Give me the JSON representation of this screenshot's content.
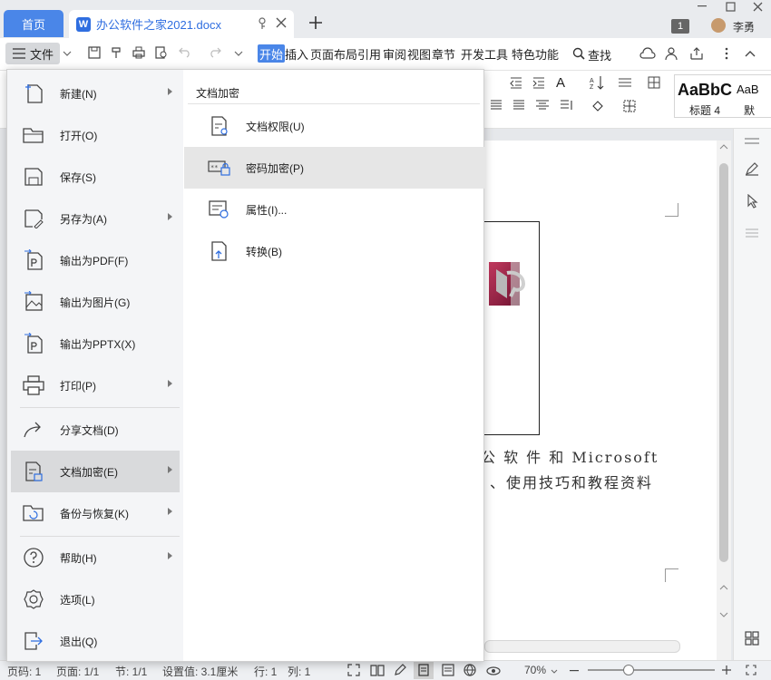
{
  "titlebar": {
    "home_tab": "首页",
    "doc_tab": "办公软件之家2021.docx",
    "doc_icon": "W",
    "badge": "1",
    "user_name": "李勇"
  },
  "toolbar": {
    "file_menu": "文件",
    "tabs": [
      "开始",
      "插入",
      "页面布局",
      "引用",
      "审阅",
      "视图",
      "章节",
      "开发工具",
      "特色功能"
    ],
    "search_label": "查找"
  },
  "ribbon": {
    "style_preview_1": "AaBbC",
    "style_preview_2": "AaB",
    "style_name_1": "标题 4",
    "style_name_2": "默"
  },
  "document": {
    "line1": "公 软 件 和 Microsoft",
    "line2": "、使用技巧和教程资料"
  },
  "status": {
    "page_count": "页码: 1",
    "page": "页面: 1/1",
    "section": "节: 1/1",
    "setting": "设置值: 3.1厘米",
    "row": "行: 1",
    "col": "列: 1",
    "zoom": "70%"
  },
  "file_menu": {
    "items": [
      {
        "label": "新建(N)",
        "icon": "new-icon",
        "submenu": true
      },
      {
        "label": "打开(O)",
        "icon": "folder-icon",
        "submenu": false
      },
      {
        "label": "保存(S)",
        "icon": "save-icon",
        "submenu": false
      },
      {
        "label": "另存为(A)",
        "icon": "save-as-icon",
        "submenu": true
      },
      {
        "label": "输出为PDF(F)",
        "icon": "export-pdf-icon",
        "submenu": false
      },
      {
        "label": "输出为图片(G)",
        "icon": "export-image-icon",
        "submenu": false
      },
      {
        "label": "输出为PPTX(X)",
        "icon": "export-pptx-icon",
        "submenu": false
      },
      {
        "label": "打印(P)",
        "icon": "print-icon",
        "submenu": true
      },
      {
        "label": "分享文档(D)",
        "icon": "share-icon",
        "submenu": false
      },
      {
        "label": "文档加密(E)",
        "icon": "encrypt-doc-icon",
        "submenu": true
      },
      {
        "label": "备份与恢复(K)",
        "icon": "backup-icon",
        "submenu": true
      },
      {
        "label": "帮助(H)",
        "icon": "help-icon",
        "submenu": true
      },
      {
        "label": "选项(L)",
        "icon": "settings-icon",
        "submenu": false
      },
      {
        "label": "退出(Q)",
        "icon": "exit-icon",
        "submenu": false
      }
    ],
    "selected": "文档加密(E)"
  },
  "submenu": {
    "title": "文档加密",
    "items": [
      {
        "label": "文档权限(U)",
        "icon": "doc-permission-icon"
      },
      {
        "label": "密码加密(P)",
        "icon": "password-lock-icon"
      },
      {
        "label": "属性(I)...",
        "icon": "properties-icon"
      },
      {
        "label": "转换(B)",
        "icon": "convert-icon"
      }
    ],
    "selected": "密码加密(P)"
  },
  "colors": {
    "accent": "#4a86e8",
    "menu_bg": "#f4f5f7",
    "selected_bg": "#d9dadc"
  }
}
